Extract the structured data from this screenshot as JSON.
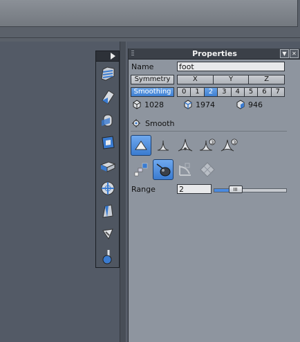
{
  "panel": {
    "title": "Properties",
    "name_label": "Name",
    "name_value": "foot",
    "symmetry_label": "Symmetry",
    "axes": [
      "X",
      "Y",
      "Z"
    ],
    "smoothing_label": "Smoothing",
    "smoothing_levels": [
      "0",
      "1",
      "2",
      "3",
      "4",
      "5",
      "6",
      "7"
    ],
    "smoothing_selected": "2",
    "stats": {
      "points": "1028",
      "edges": "1974",
      "faces": "946"
    },
    "section_title": "Smooth",
    "range_label": "Range",
    "range_value": "2",
    "range_fraction": 0.2
  },
  "colors": {
    "accent": "#4a8ae0",
    "panel_bg": "#8e959f",
    "titlebar": "#3b4048"
  },
  "icons": {
    "palette": [
      "extrude-stairs-icon",
      "bevel-icon",
      "cylinder-cut-icon",
      "mirror-icon",
      "box-plane-icon",
      "subdivide-sphere-icon",
      "loft-icon",
      "arrow-cursor-icon",
      "pin-icon"
    ],
    "shape_modes": [
      "cone-icon",
      "cone-outline-icon",
      "spike-star-icon",
      "cone-power3-icon",
      "spike-power3-icon"
    ],
    "brush_modes": [
      "scatter-dots-icon",
      "brush-drop-icon",
      "curve-fade-icon",
      "diamond-grid-icon"
    ]
  }
}
